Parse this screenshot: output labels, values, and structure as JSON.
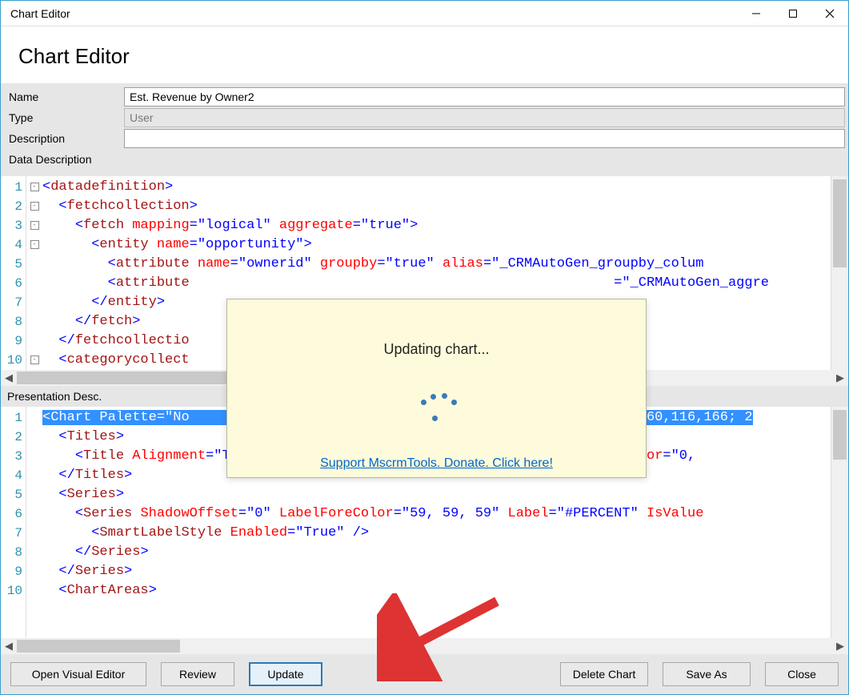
{
  "window": {
    "title": "Chart Editor"
  },
  "header": {
    "title": "Chart Editor"
  },
  "form": {
    "name_label": "Name",
    "name_value": "Est. Revenue by Owner2",
    "type_label": "Type",
    "type_value": "User",
    "description_label": "Description",
    "description_value": "",
    "data_description_label": "Data Description"
  },
  "data_editor": {
    "line_numbers": [
      "1",
      "2",
      "3",
      "4",
      "5",
      "6",
      "7",
      "8",
      "9",
      "10"
    ],
    "fold": [
      "-",
      "-",
      "-",
      "-",
      "",
      "",
      "",
      "",
      "",
      "-"
    ],
    "code_html": "<span class='s-br'>&lt;</span><span class='s-el'>datadefinition</span><span class='s-br'>&gt;</span>\n  <span class='s-br'>&lt;</span><span class='s-el'>fetchcollection</span><span class='s-br'>&gt;</span>\n    <span class='s-br'>&lt;</span><span class='s-el'>fetch</span> <span class='s-attr'>mapping</span><span class='s-br'>=</span><span class='s-val'>\"logical\"</span> <span class='s-attr'>aggregate</span><span class='s-br'>=</span><span class='s-val'>\"true\"</span><span class='s-br'>&gt;</span>\n      <span class='s-br'>&lt;</span><span class='s-el'>entity</span> <span class='s-attr'>name</span><span class='s-br'>=</span><span class='s-val'>\"opportunity\"</span><span class='s-br'>&gt;</span>\n        <span class='s-br'>&lt;</span><span class='s-el'>attribute</span> <span class='s-attr'>name</span><span class='s-br'>=</span><span class='s-val'>\"ownerid\"</span> <span class='s-attr'>groupby</span><span class='s-br'>=</span><span class='s-val'>\"true\"</span> <span class='s-attr'>alias</span><span class='s-br'>=</span><span class='s-val'>\"_CRMAutoGen_groupby_colum</span>\n        <span class='s-br'>&lt;</span><span class='s-el'>attribute</span>                                                    <span class='s-br'>=</span><span class='s-val'>\"_CRMAutoGen_aggre</span>\n      <span class='s-br'>&lt;/</span><span class='s-el'>entity</span><span class='s-br'>&gt;</span>\n    <span class='s-br'>&lt;/</span><span class='s-el'>fetch</span><span class='s-br'>&gt;</span>\n  <span class='s-br'>&lt;/</span><span class='s-el'>fetchcollectio</span>\n  <span class='s-br'>&lt;</span><span class='s-el'>categorycollect</span>"
  },
  "presentation_section": {
    "label": "Presentation Desc."
  },
  "presentation_editor": {
    "line_numbers": [
      "1",
      "2",
      "3",
      "4",
      "5",
      "6",
      "7",
      "8",
      "9",
      "10"
    ],
    "code_html": "<span class='s-sel'><span class='s-br'>&lt;</span><span class='s-el'>Chart</span> <span class='s-attr'>Palette</span><span class='s-br'>=</span><span class='s-val'>\"No                                                  ,49; 160,116,166; 2</span></span>\n  <span class='s-br'>&lt;</span><span class='s-el'>Titles</span><span class='s-br'>&gt;</span>\n    <span class='s-br'>&lt;</span><span class='s-el'>Title</span> <span class='s-attr'>Alignment</span><span class='s-br'>=</span><span class='s-val'>\"TopLeft\"</span> <span class='s-attr'>DockingOffset</span><span class='s-br'>=</span><span class='s-val'>\"-3\"</span> <span class='s-attr'>Font</span><span class='s-br'>=</span><span class='s-val'>\"{0}, 13px\"</span> <span class='s-attr'>ForeColor</span><span class='s-br'>=</span><span class='s-val'>\"0,</span>\n  <span class='s-br'>&lt;/</span><span class='s-el'>Titles</span><span class='s-br'>&gt;</span>\n  <span class='s-br'>&lt;</span><span class='s-el'>Series</span><span class='s-br'>&gt;</span>\n    <span class='s-br'>&lt;</span><span class='s-el'>Series</span> <span class='s-attr'>ShadowOffset</span><span class='s-br'>=</span><span class='s-val'>\"0\"</span> <span class='s-attr'>LabelForeColor</span><span class='s-br'>=</span><span class='s-val'>\"59, 59, 59\"</span> <span class='s-attr'>Label</span><span class='s-br'>=</span><span class='s-val'>\"#PERCENT\"</span> <span class='s-attr'>IsValue</span>\n      <span class='s-br'>&lt;</span><span class='s-el'>SmartLabelStyle</span> <span class='s-attr'>Enabled</span><span class='s-br'>=</span><span class='s-val'>\"True\"</span> <span class='s-br'>/&gt;</span>\n    <span class='s-br'>&lt;/</span><span class='s-el'>Series</span><span class='s-br'>&gt;</span>\n  <span class='s-br'>&lt;/</span><span class='s-el'>Series</span><span class='s-br'>&gt;</span>\n  <span class='s-br'>&lt;</span><span class='s-el'>ChartAreas</span><span class='s-br'>&gt;</span>"
  },
  "buttons": {
    "open_visual_editor": "Open Visual Editor",
    "review": "Review",
    "update": "Update",
    "delete_chart": "Delete Chart",
    "save_as": "Save As",
    "close": "Close"
  },
  "popup": {
    "message": "Updating chart...",
    "donate_link": "Support MscrmTools. Donate. Click here!"
  }
}
